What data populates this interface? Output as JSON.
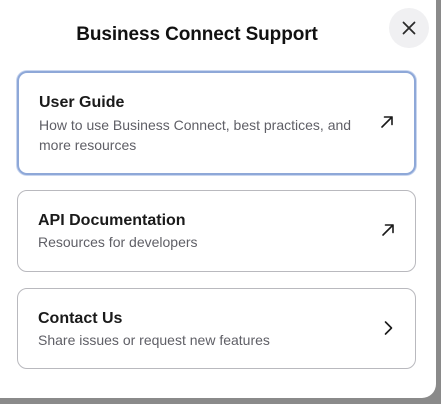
{
  "modal": {
    "title": "Business Connect Support",
    "close_icon": "close-icon"
  },
  "cards": [
    {
      "title": "User Guide",
      "description": "How to use Business Connect, best practices, and more resources",
      "icon": "external-link-arrow-icon",
      "selected": true
    },
    {
      "title": "API Documentation",
      "description": "Resources for developers",
      "icon": "external-link-arrow-icon",
      "selected": false
    },
    {
      "title": "Contact Us",
      "description": "Share issues or request new features",
      "icon": "chevron-right-icon",
      "selected": false
    }
  ],
  "colors": {
    "selected_border": "#8ea8d8",
    "card_border": "#b9b9be",
    "title_text": "#111111",
    "description_text": "#5f5f66"
  }
}
